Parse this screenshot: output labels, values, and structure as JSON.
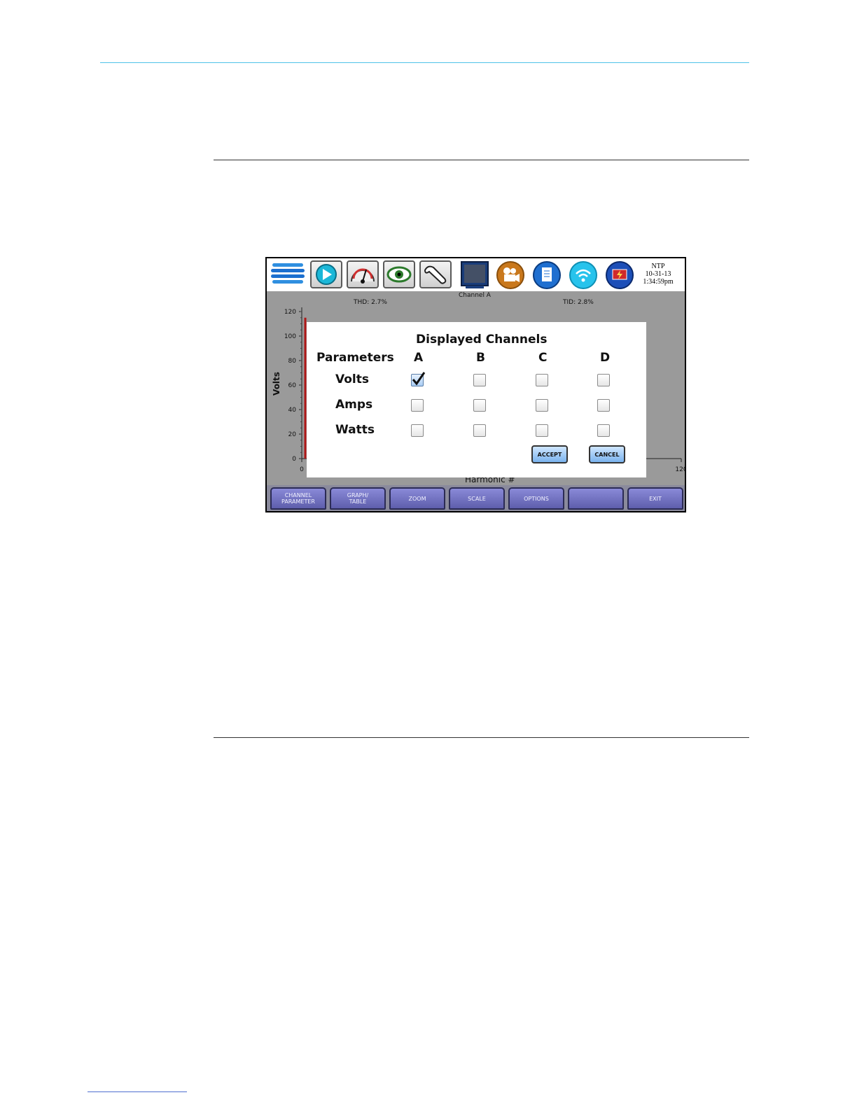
{
  "topbar": {
    "icons": [
      "menu-icon",
      "play-icon",
      "meter-icon",
      "eye-icon",
      "wrench-icon",
      "monitor-icon",
      "camera-icon",
      "document-icon",
      "wireless-icon",
      "power-event-icon"
    ],
    "datetime": {
      "line1": "NTP",
      "line2": "10-31-13",
      "line3": "1:34:59pm"
    }
  },
  "chart": {
    "channel": "Channel A",
    "thd": "THD: 2.7%",
    "tid": "TID: 2.8%",
    "ylabel": "Volts",
    "xlabel": "Harmonic #",
    "yticks": [
      "120",
      "100",
      "80",
      "60",
      "40",
      "20",
      "0"
    ],
    "xticks": [
      "0",
      "120"
    ]
  },
  "chart_data": {
    "type": "bar",
    "xlabel": "Harmonic #",
    "ylabel": "Volts",
    "ylim": [
      0,
      120
    ],
    "xlim": [
      0,
      120
    ],
    "annotations": [
      "Channel A",
      "THD: 2.7%",
      "TID: 2.8%"
    ],
    "series": [
      {
        "x": [
          1
        ],
        "values": [
          115
        ]
      }
    ]
  },
  "dialog": {
    "title": "Displayed Channels",
    "param_header": "Parameters",
    "columns": [
      "A",
      "B",
      "C",
      "D"
    ],
    "rows": [
      {
        "label": "Volts",
        "checked": [
          true,
          false,
          false,
          false
        ]
      },
      {
        "label": "Amps",
        "checked": [
          false,
          false,
          false,
          false
        ]
      },
      {
        "label": "Watts",
        "checked": [
          false,
          false,
          false,
          false
        ]
      }
    ],
    "accept": "ACCEPT",
    "cancel": "CANCEL"
  },
  "softkeys": [
    "CHANNEL\nPARAMETER",
    "GRAPH/\nTABLE",
    "ZOOM",
    "SCALE",
    "OPTIONS",
    "",
    "EXIT"
  ]
}
